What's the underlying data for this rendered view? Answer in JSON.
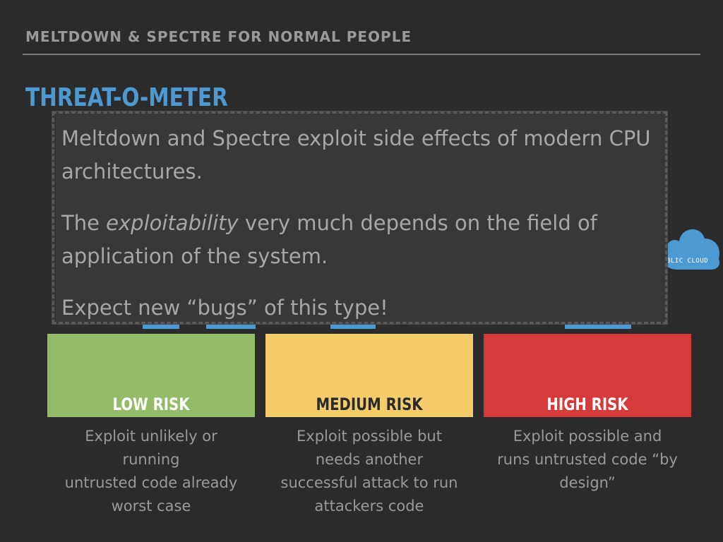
{
  "header": {
    "subtitle": "MELTDOWN & SPECTRE FOR NORMAL PEOPLE"
  },
  "slide": {
    "title": "THREAT-O-METER",
    "accent_color": "#4d9ad3"
  },
  "overlay": {
    "paragraph1": "Meltdown and Spectre exploit side effects of modern CPU architectures.",
    "paragraph2_before": "The ",
    "paragraph2_emphasis": "exploitability",
    "paragraph2_after": " very much depends on the field of application of the system.",
    "paragraph3": "Expect new “bugs” of this type!"
  },
  "cloud": {
    "label": "BLIC CLOUD",
    "icon": "cloud-icon",
    "color": "#4d9ad3"
  },
  "risks": [
    {
      "label": "LOW RISK",
      "color": "#94bb67",
      "text_color": "#ffffff",
      "description_lines": [
        "Exploit unlikely or",
        "running",
        "untrusted code already",
        "worst case"
      ]
    },
    {
      "label": "MEDIUM RISK",
      "color": "#f4cc6a",
      "text_color": "#2b2b2b",
      "description_lines": [
        "Exploit possible but",
        "needs another",
        "successful attack to run",
        "attackers code"
      ]
    },
    {
      "label": "HIGH RISK",
      "color": "#d63a3a",
      "text_color": "#ffffff",
      "description_lines": [
        "Exploit possible and",
        "runs untrusted code “by",
        "design”"
      ]
    }
  ]
}
